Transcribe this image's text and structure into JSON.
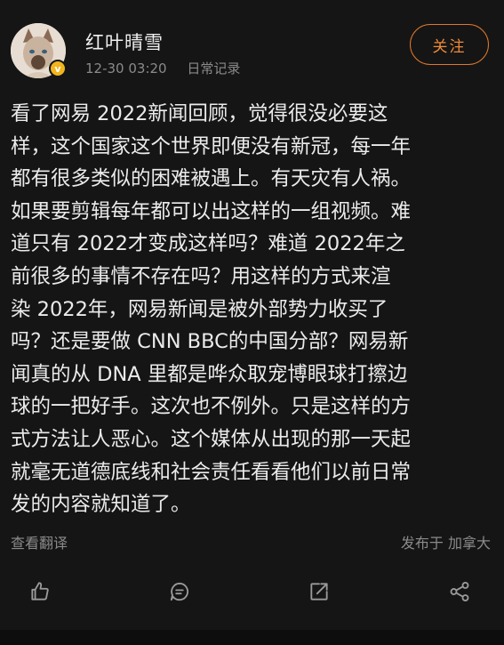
{
  "post": {
    "username": "红叶晴雪",
    "timestamp": "12-30 03:20",
    "category": "日常记录",
    "follow_label": "关注",
    "content_lines": [
      "看了网易 2022新闻回顾，觉得很没必要这",
      "样，这个国家这个世界即便没有新冠，每一年",
      "都有很多类似的困难被遇上。有天灾有人祸。",
      "如果要剪辑每年都可以出这样的一组视频。难",
      "道只有 2022才变成这样吗？难道 2022年之",
      "前很多的事情不存在吗？用这样的方式来渲",
      "染 2022年，网易新闻是被外部势力收买了",
      "吗？还是要做 CNN BBC的中国分部？网易新",
      "闻真的从 DNA 里都是哗众取宠博眼球打擦边",
      "球的一把好手。这次也不例外。只是这样的方",
      "式方法让人恶心。这个媒体从出现的那一天起",
      "就毫无道德底线和社会责任看看他们以前日常",
      "发的内容就知道了。"
    ],
    "translate_label": "查看翻译",
    "location": "发布于 加拿大"
  },
  "actions": {
    "like_icon": "thumbs-up-icon",
    "comment_icon": "comment-icon",
    "share_icon": "share-icon",
    "more_share_icon": "share-nodes-icon"
  },
  "colors": {
    "background": "#151515",
    "accent": "#f08a3a",
    "verified": "#f2b51f",
    "muted_text": "#8a8a8a"
  }
}
